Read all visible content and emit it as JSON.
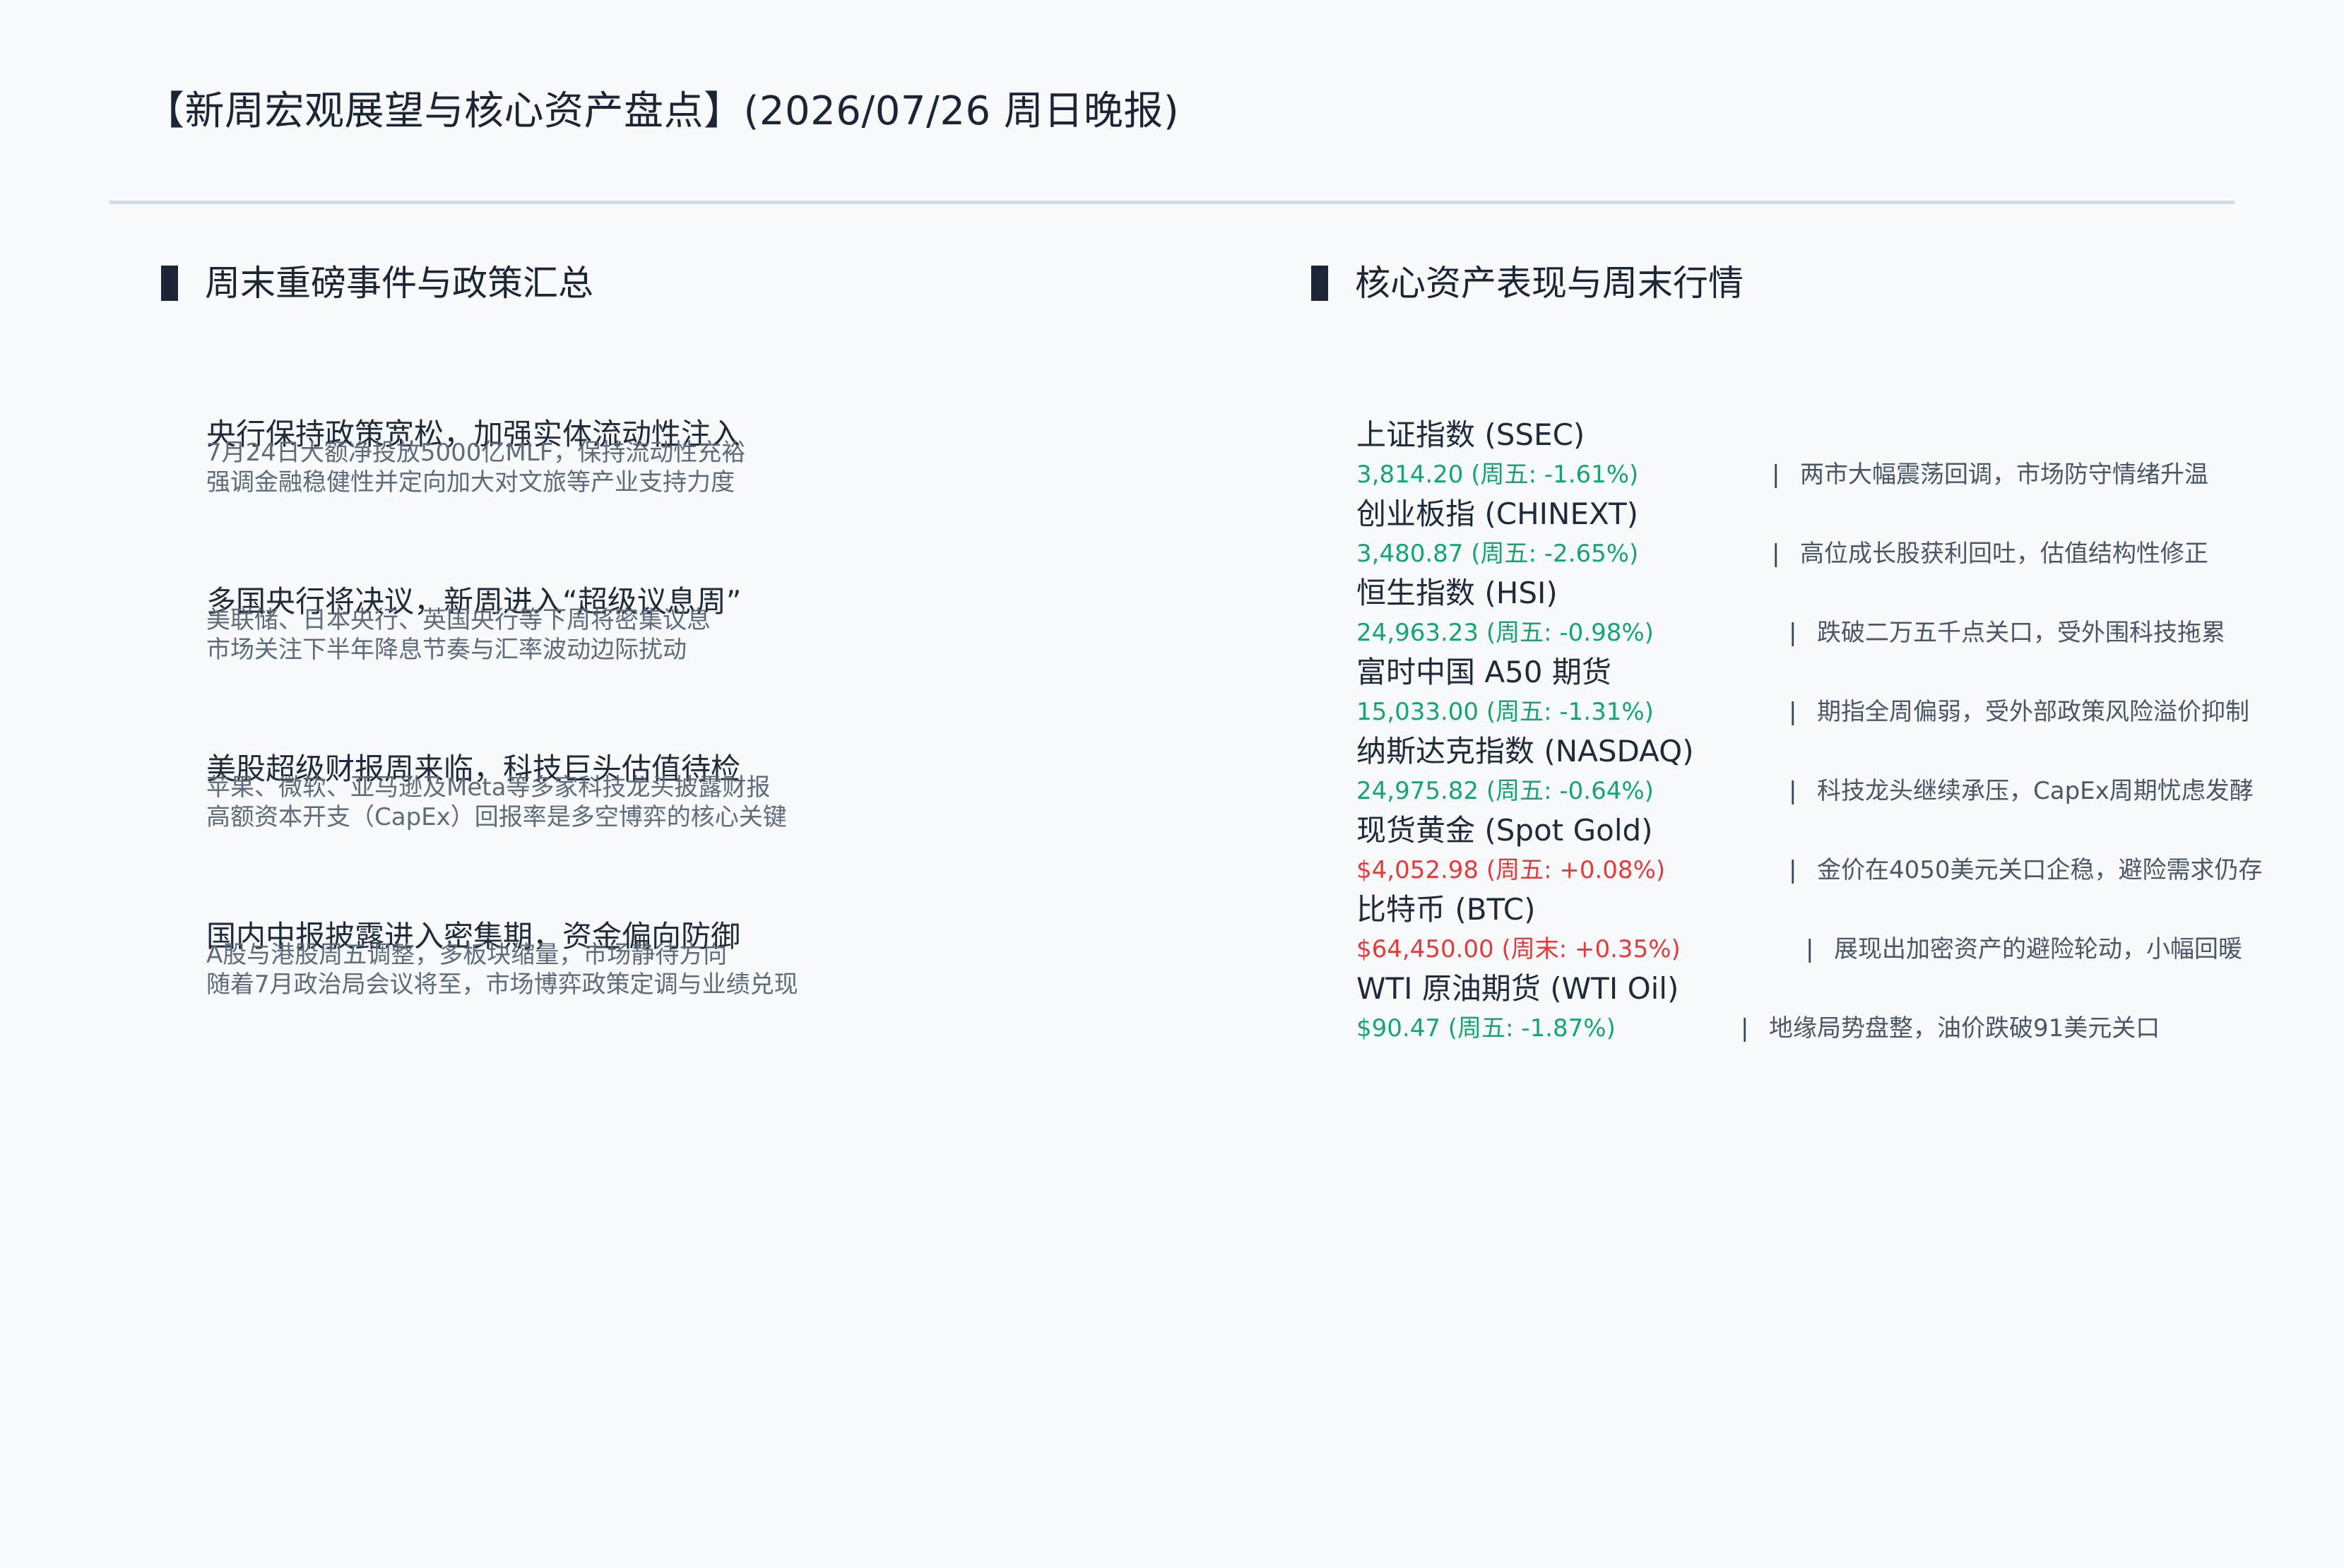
{
  "page": {
    "title": "【新周宏观展望与核心资产盘点】(2026/07/26 周日晚报)"
  },
  "left_section": {
    "title": "周末重磅事件与政策汇总",
    "events": [
      {
        "title": "央行保持政策宽松，加强实体流动性注入",
        "lines": [
          "7月24日大额净投放5000亿MLF，保持流动性充裕",
          "强调金融稳健性并定向加大对文旅等产业支持力度"
        ]
      },
      {
        "title": "多国央行将决议，新周进入“超级议息周”",
        "lines": [
          "美联储、日本央行、英国央行等下周将密集议息",
          "市场关注下半年降息节奏与汇率波动边际扰动"
        ]
      },
      {
        "title": "美股超级财报周来临，科技巨头估值待检",
        "lines": [
          "苹果、微软、亚马逊及Meta等多家科技龙头披露财报",
          "高额资本开支（CapEx）回报率是多空博弈的核心关键"
        ]
      },
      {
        "title": "国内中报披露进入密集期，资金偏向防御",
        "lines": [
          "A股与港股周五调整，多板块缩量，市场静待方向",
          "随着7月政治局会议将至，市场博弈政策定调与业绩兑现"
        ]
      }
    ]
  },
  "right_section": {
    "title": "核心资产表现与周末行情",
    "separator": "|",
    "assets": [
      {
        "name": "上证指数 (SSEC)",
        "value": "3,814.20 (周五: -1.61%)",
        "direction": "down",
        "comment": "两市大幅震荡回调，市场防守情绪升温"
      },
      {
        "name": "创业板指 (CHINEXT)",
        "value": "3,480.87 (周五: -2.65%)",
        "direction": "down",
        "comment": "高位成长股获利回吐，估值结构性修正"
      },
      {
        "name": "恒生指数 (HSI)",
        "value": "24,963.23 (周五: -0.98%)",
        "direction": "down",
        "comment": "跌破二万五千点关口，受外围科技拖累"
      },
      {
        "name": "富时中国 A50 期货",
        "value": "15,033.00 (周五: -1.31%)",
        "direction": "down",
        "comment": "期指全周偏弱，受外部政策风险溢价抑制"
      },
      {
        "name": "纳斯达克指数 (NASDAQ)",
        "value": "24,975.82 (周五: -0.64%)",
        "direction": "down",
        "comment": "科技龙头继续承压，CapEx周期忧虑发酵"
      },
      {
        "name": "现货黄金 (Spot Gold)",
        "value": "$4,052.98 (周五: +0.08%)",
        "direction": "up",
        "comment": "金价在4050美元关口企稳，避险需求仍存"
      },
      {
        "name": "比特币 (BTC)",
        "value": "$64,450.00 (周末: +0.35%)",
        "direction": "up",
        "comment": "展现出加密资产的避险轮动，小幅回暖"
      },
      {
        "name": "WTI 原油期货 (WTI Oil)",
        "value": "$90.47 (周五: -1.87%)",
        "direction": "down",
        "comment": "地缘局势盘整，油价跌破91美元关口"
      }
    ]
  },
  "colors": {
    "down": "#16a571",
    "up": "#e23b3b",
    "title_rule": "#d4dde6",
    "section_bar": "#1c2535"
  }
}
